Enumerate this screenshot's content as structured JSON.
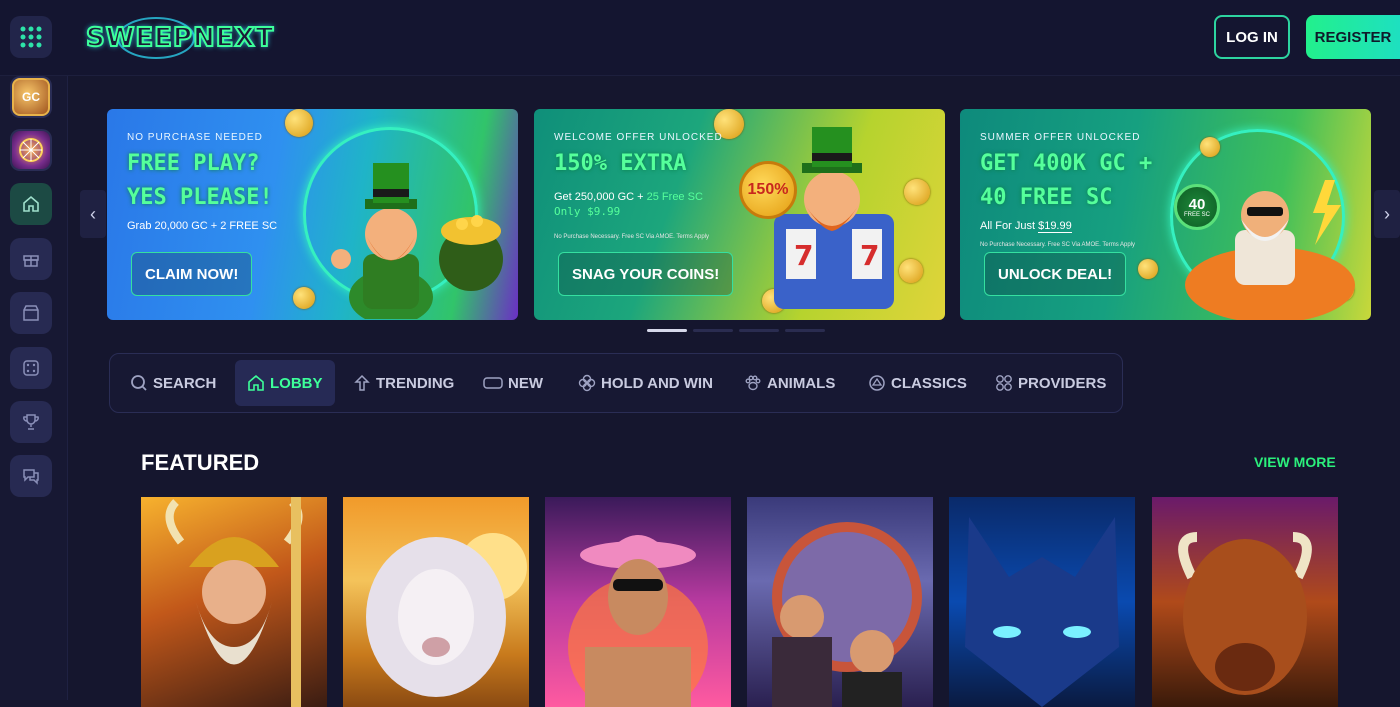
{
  "header": {
    "logo_text": "SWEEPNEXT",
    "login_label": "LOG IN",
    "register_label": "REGISTER"
  },
  "sidebar": {
    "items": [
      "grid-icon",
      "gc-coin-icon",
      "wheel-icon",
      "home-icon",
      "gift-icon",
      "store-icon",
      "dice-icon",
      "trophy-icon",
      "chat-icon"
    ],
    "coin_label": "GC"
  },
  "banners": [
    {
      "kicker": "NO PURCHASE NEEDED",
      "title_line1": "FREE PLAY?",
      "title_line2": "YES PLEASE!",
      "subtitle": "Grab 20,000 GC + 2 FREE SC",
      "button": "CLAIM NOW!"
    },
    {
      "kicker": "WELCOME OFFER UNLOCKED",
      "title_line1": "150% EXTRA",
      "offer_prefix": "Get 250,000 GC + ",
      "offer_highlight": "25 Free SC",
      "price": "Only $9.99",
      "fine_print": "No Purchase Necessary. Free SC Via AMOE. Terms Apply",
      "badge": "150%",
      "button": "SNAG YOUR COINS!"
    },
    {
      "kicker": "SUMMER OFFER UNLOCKED",
      "title_line1": "GET 400K GC +",
      "title_line2": "40 FREE SC",
      "offer_prefix": "All For Just ",
      "offer_price": "$19.99",
      "fine_print": "No Purchase Necessary. Free SC Via AMOE. Terms Apply",
      "badge_num": "40",
      "badge_text": "FREE SC",
      "button": "UNLOCK DEAL!"
    }
  ],
  "carousel": {
    "active_index": 0,
    "count": 4
  },
  "categories": [
    {
      "label": "SEARCH",
      "icon": "search-icon"
    },
    {
      "label": "LOBBY",
      "icon": "home-icon"
    },
    {
      "label": "TRENDING",
      "icon": "trending-icon"
    },
    {
      "label": "NEW",
      "icon": "new-icon"
    },
    {
      "label": "HOLD AND WIN",
      "icon": "clover-icon"
    },
    {
      "label": "ANIMALS",
      "icon": "paw-icon"
    },
    {
      "label": "CLASSICS",
      "icon": "classics-icon"
    },
    {
      "label": "PROVIDERS",
      "icon": "providers-icon"
    }
  ],
  "featured": {
    "title": "FEATURED",
    "view_more": "VIEW MORE",
    "games": [
      "viking-warrior-game",
      "white-lion-game",
      "beach-woman-game",
      "gangsters-game",
      "blue-wolf-game",
      "buffalo-game"
    ]
  },
  "colors": {
    "accent": "#3dff9a",
    "teal": "#1ee0c0",
    "bg": "#15162e"
  }
}
